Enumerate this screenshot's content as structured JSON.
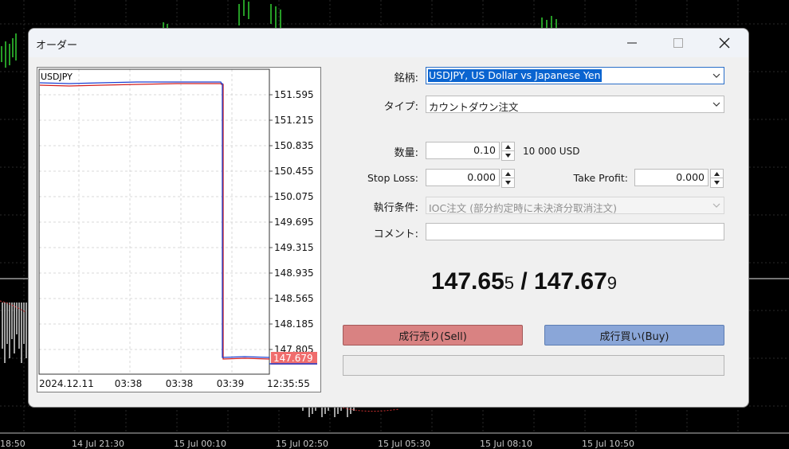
{
  "background": {
    "time_labels": [
      "18:50",
      "14 Jul 21:30",
      "15 Jul 00:10",
      "15 Jul 02:50",
      "15 Jul 05:30",
      "15 Jul 08:10",
      "15 Jul 10:50"
    ]
  },
  "dialog": {
    "title": "オーダー"
  },
  "mini_chart": {
    "symbol": "USDJPY",
    "y_ticks": [
      "151.595",
      "151.215",
      "150.835",
      "150.455",
      "150.075",
      "149.695",
      "149.315",
      "148.935",
      "148.565",
      "148.185",
      "147.805"
    ],
    "current_price_label": "147.679",
    "x_ticks": [
      "2024.12.11",
      "03:38",
      "03:38",
      "03:39",
      "12:35:55"
    ],
    "line_color_bid": "#d11c1c",
    "line_color_ask": "#1c3fd1",
    "price_tag_color": "#f06d6d"
  },
  "form": {
    "symbol_label": "銘柄:",
    "symbol_value": "USDJPY, US Dollar vs Japanese Yen",
    "type_label": "タイプ:",
    "type_value": "カウントダウン注文",
    "volume_label": "数量:",
    "volume_value": "0.10",
    "volume_unit": "10 000 USD",
    "stop_loss_label": "Stop Loss:",
    "stop_loss_value": "0.000",
    "take_profit_label": "Take Profit:",
    "take_profit_value": "0.000",
    "fill_label": "執行条件:",
    "fill_value": "IOC注文 (部分約定時に未決済分取消注文)",
    "comment_label": "コメント:",
    "comment_value": ""
  },
  "quote": {
    "bid_main": "147.65",
    "bid_small": "5",
    "separator": " / ",
    "ask_main": "147.67",
    "ask_small": "9"
  },
  "buttons": {
    "sell_label": "成行売り(Sell)",
    "buy_label": "成行買い(Buy)"
  },
  "icons": {
    "minimize": "minimize-icon",
    "maximize": "maximize-icon",
    "close": "close-icon",
    "dropdown": "chevron-down-icon",
    "spin_up": "arrow-up-icon",
    "spin_down": "arrow-down-icon"
  }
}
